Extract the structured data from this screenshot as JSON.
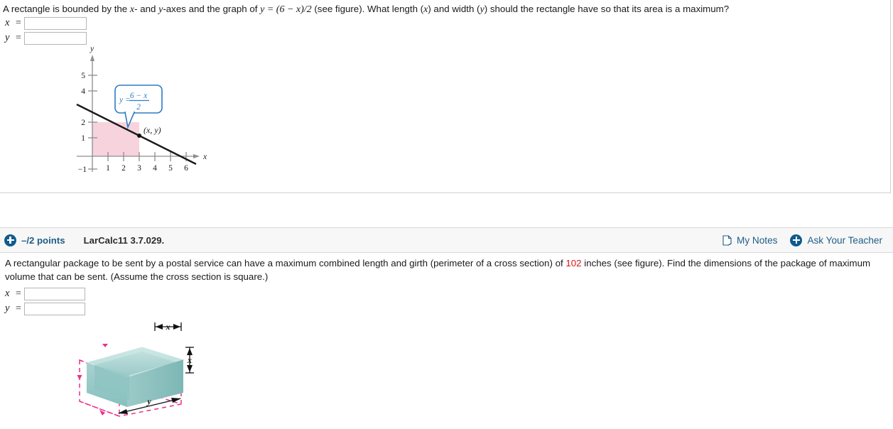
{
  "question1": {
    "prompt_part1": "A rectangle is bounded by the ",
    "prompt_x": "x",
    "prompt_part2": "- and ",
    "prompt_y": "y",
    "prompt_part3": "-axes and the graph of ",
    "prompt_equation": "y = (6 − x)/2",
    "prompt_part4": " (see figure). What length (",
    "prompt_x2": "x",
    "prompt_part5": ") and width (",
    "prompt_y2": "y",
    "prompt_part6": ") should the rectangle have so that its area is a maximum?",
    "answers": [
      {
        "label": "x",
        "equals": "=",
        "value": "",
        "placeholder": ""
      },
      {
        "label": "y",
        "equals": "=",
        "value": "",
        "placeholder": ""
      }
    ],
    "figure": {
      "type": "line-graph",
      "axis_x_label": "x",
      "axis_y_label": "y",
      "x_ticks": [
        "1",
        "2",
        "3",
        "4",
        "5",
        "6"
      ],
      "y_ticks": [
        "5",
        "4",
        "2",
        "1",
        "−1"
      ],
      "callout_lhs": "y =",
      "callout_numerator": "6 − x",
      "callout_denominator": "2",
      "point_label": "(x, y)",
      "shaded_rect_color": "#f7d3de",
      "callout_color": "#2e7cc4",
      "line_color": "#1a1a1a"
    }
  },
  "question2": {
    "header": {
      "points": "–/2 points",
      "code": "LarCalc11 3.7.029.",
      "my_notes": "My Notes",
      "ask_teacher": "Ask Your Teacher",
      "plus_icon": "plus-circle-icon",
      "notes_icon": "note-page-icon",
      "accent_color": "#1f5d86"
    },
    "prompt_part1": "A rectangular package to be sent by a postal service can have a maximum combined length and girth (perimeter of a cross section) of ",
    "prompt_value": "102",
    "prompt_value_color": "#d81616",
    "prompt_part2": " inches (see figure). Find the dimensions of the package of maximum volume that can be sent. (Assume the cross section is square.)",
    "answers": [
      {
        "label": "x",
        "equals": "=",
        "value": "",
        "placeholder": ""
      },
      {
        "label": "y",
        "equals": "=",
        "value": "",
        "placeholder": ""
      }
    ],
    "figure": {
      "type": "3d-box-diagram",
      "dim_top_label": "x",
      "dim_side_label": "x",
      "dim_length_label": "y",
      "box_fill_light": "#bfe0de",
      "box_fill_mid": "#9ccbca",
      "box_fill_dark": "#7fb9b8",
      "girth_color": "#ec2f8a"
    }
  },
  "chart_data": {
    "type": "line",
    "title": "",
    "xlabel": "x",
    "ylabel": "y",
    "xlim": [
      -0.6,
      7.0
    ],
    "ylim": [
      -1.6,
      5.8
    ],
    "x_ticks": [
      1,
      2,
      3,
      4,
      5,
      6
    ],
    "y_ticks": [
      -1,
      1,
      2,
      4,
      5
    ],
    "grid": false,
    "legend": "none",
    "series": [
      {
        "name": "y = (6 - x)/2",
        "x": [
          -0.6,
          6.6
        ],
        "y": [
          3.3,
          -0.3
        ]
      }
    ],
    "annotations": [
      {
        "text": "y = (6 − x)/2",
        "type": "callout",
        "x": 2.6,
        "y": 3.2
      },
      {
        "text": "(x, y)",
        "type": "point-label",
        "x": 3.0,
        "y": 1.5
      }
    ],
    "shaded_region": {
      "x0": 0,
      "y0": 0,
      "x1": 3,
      "y1": 1.5,
      "color": "#f7d3de"
    }
  }
}
